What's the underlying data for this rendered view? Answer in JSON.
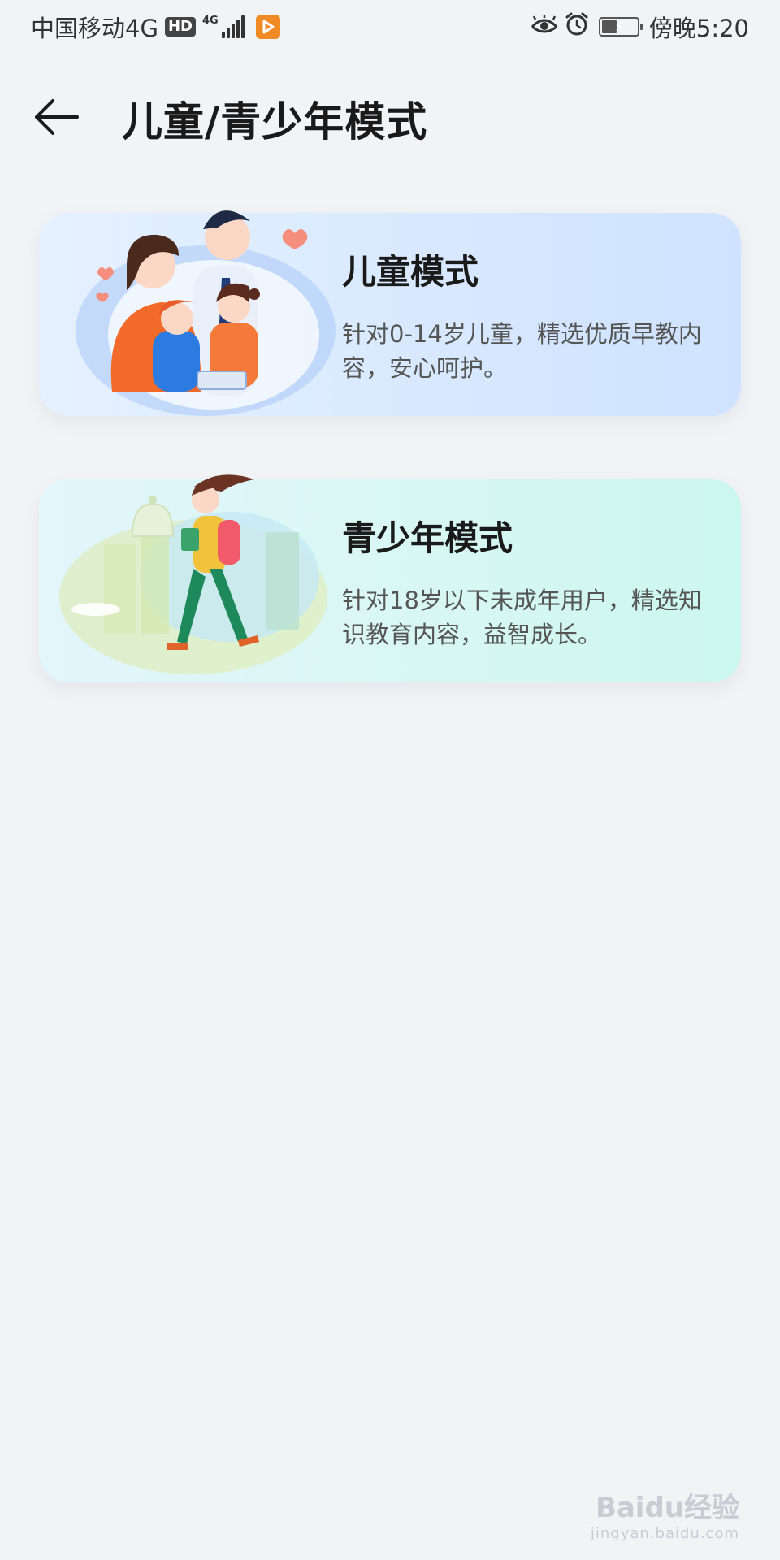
{
  "status_bar": {
    "carrier": "中国移动4G",
    "hd_label": "HD",
    "network_label": "4G",
    "time": "傍晚5:20",
    "icons": [
      "hd-icon",
      "signal-icon",
      "video-app-icon",
      "eye-icon",
      "alarm-icon",
      "battery-charging-icon"
    ]
  },
  "header": {
    "back_icon": "arrow-left-icon",
    "title": "儿童/青少年模式"
  },
  "cards": [
    {
      "title": "儿童模式",
      "description": "针对0-14岁儿童，精选优质早教内容，安心呵护。",
      "illustration": "family-illustration",
      "colors": {
        "bg_start": "#e6f1ff",
        "bg_end": "#cfe3ff"
      }
    },
    {
      "title": "青少年模式",
      "description": "针对18岁以下未成年用户，精选知识教育内容，益智成长。",
      "illustration": "student-walking-illustration",
      "colors": {
        "bg_start": "#e2f6fb",
        "bg_end": "#cbf7ee"
      }
    }
  ],
  "watermark": {
    "brand": "Baidu经验",
    "url": "jingyan.baidu.com"
  },
  "colors": {
    "page_background": "#f2f3f5",
    "title_text": "#1a1a1a",
    "secondary_text": "#555555"
  }
}
